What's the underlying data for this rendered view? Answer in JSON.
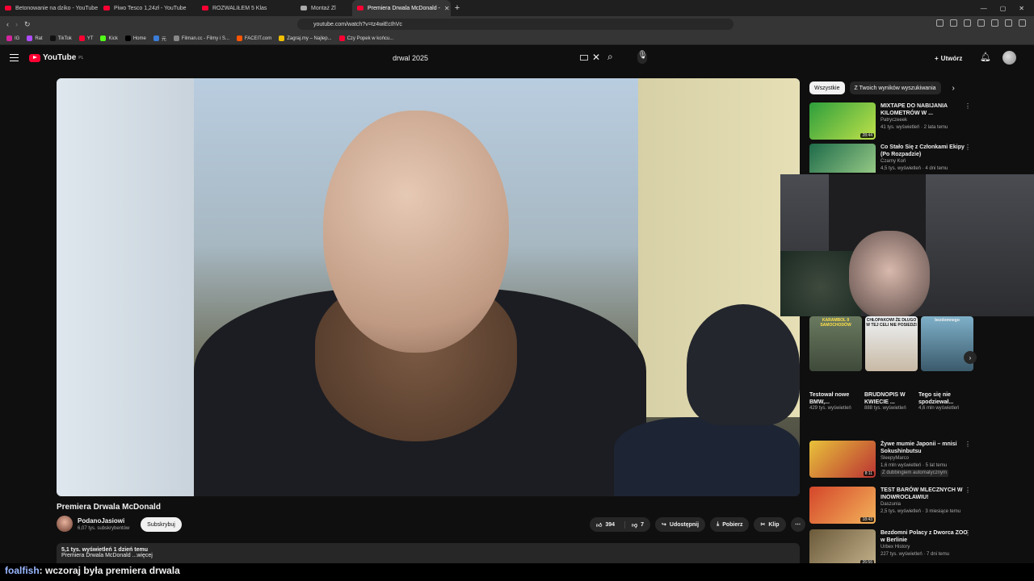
{
  "tabs": [
    {
      "label": "Betonowanie na dziko - YouTube"
    },
    {
      "label": "Piwo Tesco 1,24zł - YouTube"
    },
    {
      "label": "ROZWALIŁEM 5 Klas"
    },
    {
      "label": "Montaż Zl"
    },
    {
      "label": "Premiera Drwala McDonald -"
    }
  ],
  "address": {
    "url": "youtube.com/watch?v=tz4wiEcIhVc"
  },
  "bookmarks": [
    {
      "label": "IG"
    },
    {
      "label": "Rat"
    },
    {
      "label": "TikTok"
    },
    {
      "label": "YT"
    },
    {
      "label": "Kick"
    },
    {
      "label": "Home"
    },
    {
      "label": "元"
    },
    {
      "label": "Filman.cc - Filmy i S..."
    },
    {
      "label": "FACEIT.com"
    },
    {
      "label": "Zagraj.my – Najlep..."
    },
    {
      "label": "Czy Popek w końcu..."
    }
  ],
  "header": {
    "logo": "YouTube",
    "region": "PL",
    "search_value": "drwal 2025",
    "create_label": "Utwórz"
  },
  "video": {
    "title": "Premiera Drwala McDonald",
    "channel": "PodanoJasiowi",
    "subscribers": "6,07 tys. subskrybentów",
    "subscribe_label": "Subskrybuj",
    "likes": "394",
    "dislikes": "7",
    "share_label": "Udostępnij",
    "download_label": "Pobierz",
    "clip_label": "Klip",
    "views_meta": "5,1 tys. wyświetleń  1 dzień temu",
    "description": "Premiera Drwala McDonald ...więcej"
  },
  "sidebar": {
    "chips": [
      "Wszystkie",
      "Z Twoich wyników wyszukiwania"
    ],
    "recs_top": [
      {
        "title": "MIXTAPE DO NABIJANIA KILOMETRÓW W ...",
        "channel": "Patryczeeek",
        "meta": "41 tys. wyświetleń · 2 lata temu",
        "duration": "28:44"
      },
      {
        "title": "Co Stało Się z Członkami Ekipy (Po Rozpadzie)",
        "channel": "Czarny Koń",
        "meta": "4,5 tys. wyświetleń · 4 dni temu",
        "duration": ""
      }
    ],
    "shorts_caps": [
      "KARAMBOL 9 SAMOCHODÓW",
      "CHŁOPAKOWI ŻE DŁUGO W TEJ CELI NIE POSIEDZI",
      "bezdomnego"
    ],
    "shorts": [
      {
        "title": "Testował nowe BMW,...",
        "views": "429 tys. wyświetleń"
      },
      {
        "title": "BRUDNOPIS W KWIECIE ...",
        "views": "888 tys. wyświetleń"
      },
      {
        "title": "Tego się nie spodziewał...",
        "views": "4,6 mln wyświetleń"
      }
    ],
    "recs_bottom": [
      {
        "title": "Żywe mumie Japonii – mnisi Sokushinbutsu",
        "channel": "SleepyMarco",
        "meta": "1,6 mln wyświetleń · 5 lat temu",
        "badge": "Z dubbingiem automatycznym",
        "duration": "8:11"
      },
      {
        "title": "TEST BARÓW MLECZNYCH W INOWROCŁAWIU!",
        "channel": "Daszunia",
        "meta": "2,5 tys. wyświetleń · 3 miesiące temu",
        "duration": "18:43"
      },
      {
        "title": "Bezdomni Polacy z Dworca ZOO w Berlinie",
        "channel": "Urbex History",
        "meta": "227 tys. wyświetleń · 7 dni temu",
        "duration": "26:56"
      }
    ]
  },
  "chat": {
    "user": "foalfish",
    "message": ": wczoraj była premiera drwala"
  },
  "colors": {
    "accent": "#ff0033",
    "bg": "#0f0f0f"
  }
}
